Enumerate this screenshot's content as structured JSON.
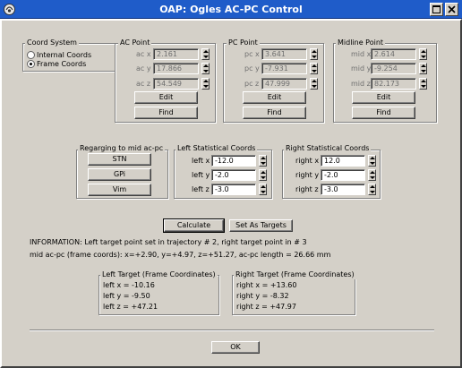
{
  "window": {
    "title": "OAP: Ogles AC-PC Control"
  },
  "coord_system": {
    "label": "Coord System",
    "options": [
      {
        "label": "Internal Coords",
        "selected": false
      },
      {
        "label": "Frame Coords",
        "selected": true
      }
    ]
  },
  "ac_point": {
    "label": "AC Point",
    "x_label": "ac x",
    "y_label": "ac y",
    "z_label": "ac z",
    "x": "2.161",
    "y": "17.866",
    "z": "54.549",
    "edit": "Edit",
    "find": "Find"
  },
  "pc_point": {
    "label": "PC Point",
    "x_label": "pc x",
    "y_label": "pc y",
    "z_label": "pc z",
    "x": "3.641",
    "y": "-7.931",
    "z": "47.999",
    "edit": "Edit",
    "find": "Find"
  },
  "midline_point": {
    "label": "Midline Point",
    "x_label": "mid x",
    "y_label": "mid y",
    "z_label": "mid z",
    "x": "2.614",
    "y": "-9.254",
    "z": "82.173",
    "edit": "Edit",
    "find": "Find"
  },
  "regarding": {
    "label": "Regarging to mid ac-pc",
    "buttons": [
      "STN",
      "GPi",
      "Vim"
    ]
  },
  "left_stat": {
    "label": "Left Statistical Coords",
    "x_label": "left x",
    "y_label": "left y",
    "z_label": "left z",
    "x": "-12.0",
    "y": "-2.0",
    "z": "-3.0"
  },
  "right_stat": {
    "label": "Right Statistical Coords",
    "x_label": "right x",
    "y_label": "right y",
    "z_label": "right z",
    "x": "12.0",
    "y": "-2.0",
    "z": "-3.0"
  },
  "actions": {
    "calculate": "Calculate",
    "set_targets": "Set As Targets"
  },
  "info": {
    "line1": "INFORMATION: Left target point set in trajectory # 2, right target point in # 3",
    "line2": "mid ac-pc (frame coords): x=+2.90, y=+4.97, z=+51.27,  ac-pc length = 26.66 mm"
  },
  "left_target": {
    "label": "Left Target (Frame Coordinates)",
    "x": "left x = -10.16",
    "y": "left y = -9.50",
    "z": "left z = +47.21"
  },
  "right_target": {
    "label": "Right Target (Frame Coordinates)",
    "x": "right x = +13.60",
    "y": "right y = -8.32",
    "z": "right z = +47.97"
  },
  "ok": "OK"
}
